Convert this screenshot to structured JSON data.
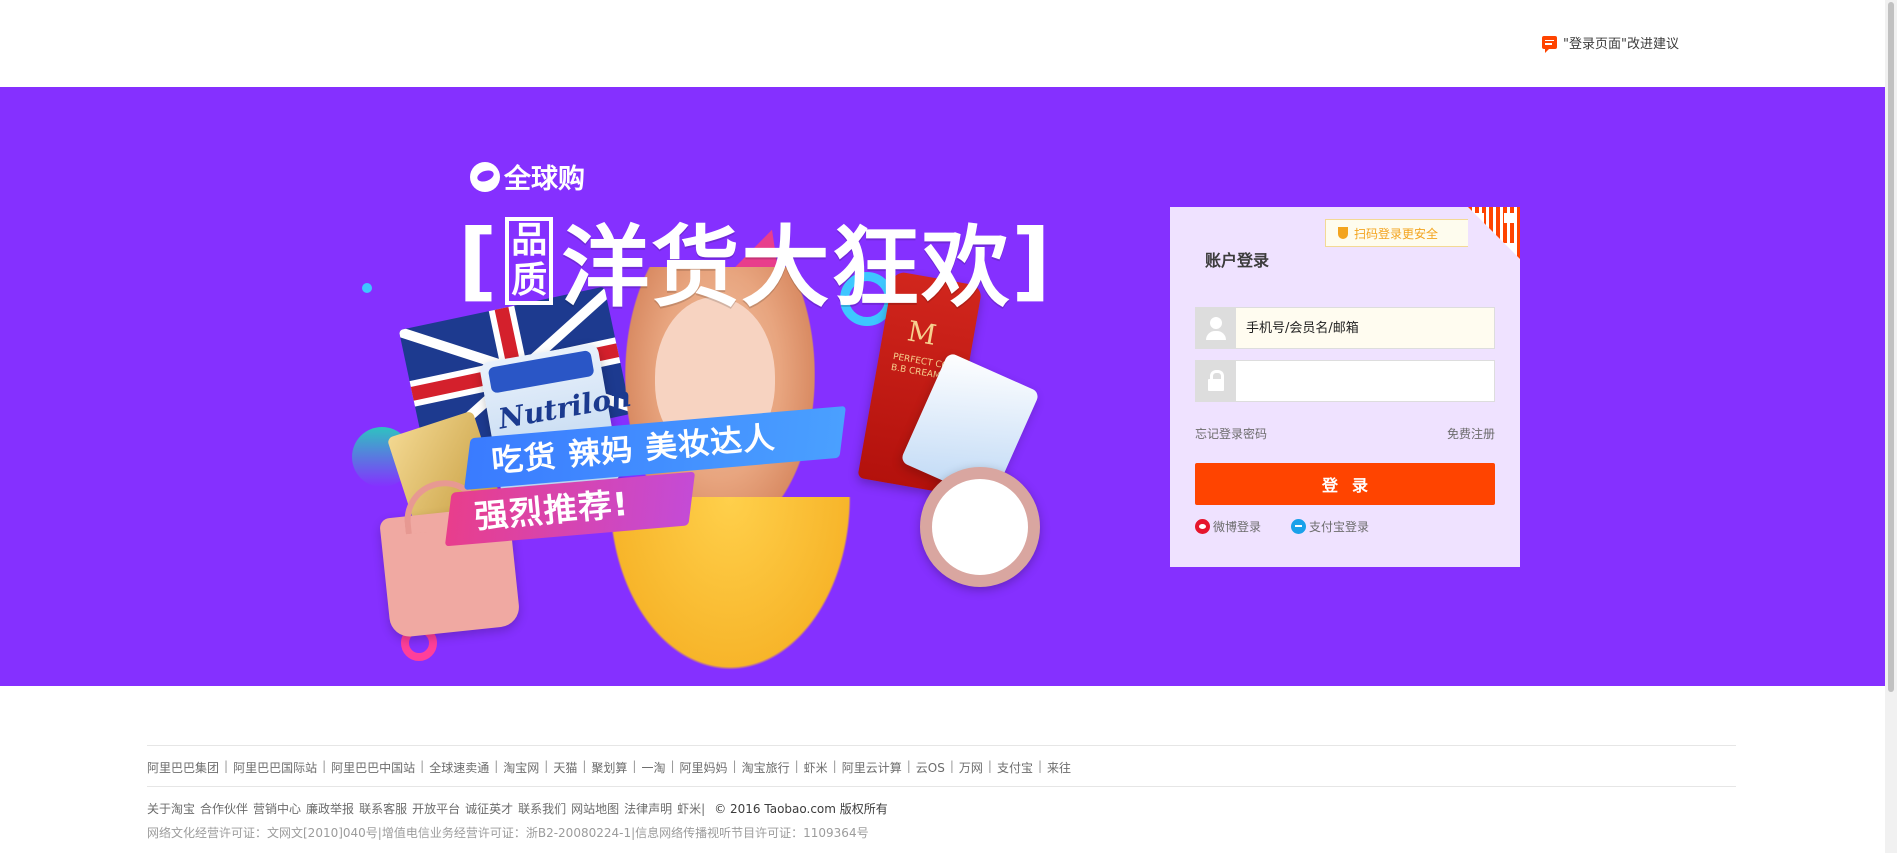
{
  "header": {
    "feedback_label": "\"登录页面\"改进建议"
  },
  "promo": {
    "brand": "全球购",
    "bracket_left": "[",
    "quality_line1": "品",
    "quality_line2": "质",
    "headline": "洋货大狂欢",
    "bracket_right": "]",
    "ribbon1": "吃货 辣妈 美妆达人",
    "ribbon2": "强烈推荐!",
    "product_can": "Nutrilon",
    "product_tube_logo": "M",
    "product_tube_text": "PERFECT COVER B.B CREAM",
    "colors": {
      "background": "#8530ff",
      "accent": "#ff4400"
    }
  },
  "login": {
    "title": "账户登录",
    "qr_tip": "扫码登录更安全",
    "username_placeholder": "手机号/会员名/邮箱",
    "password_value": "",
    "forgot_password": "忘记登录密码",
    "register": "免费注册",
    "submit_label": "登录",
    "weibo_login": "微博登录",
    "alipay_login": "支付宝登录"
  },
  "footer": {
    "links": [
      "阿里巴巴集团",
      "阿里巴巴国际站",
      "阿里巴巴中国站",
      "全球速卖通",
      "淘宝网",
      "天猫",
      "聚划算",
      "一淘",
      "阿里妈妈",
      "淘宝旅行",
      "虾米",
      "阿里云计算",
      "云OS",
      "万网",
      "支付宝",
      "来往"
    ],
    "about_links": [
      "关于淘宝",
      "合作伙伴",
      "营销中心",
      "廉政举报",
      "联系客服",
      "开放平台",
      "诚征英才",
      "联系我们",
      "网站地图",
      "法律声明",
      "虾米|"
    ],
    "copyright": "© 2016 Taobao.com 版权所有",
    "license": "网络文化经营许可证：文网文[2010]040号|增值电信业务经营许可证：浙B2-20080224-1|信息网络传播视听节目许可证：1109364号"
  }
}
